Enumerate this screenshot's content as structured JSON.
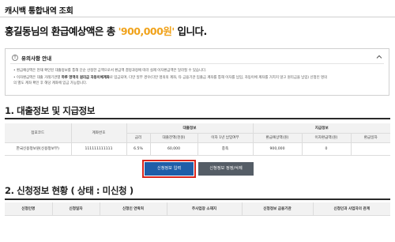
{
  "page": {
    "title": "캐시백 통합내역 조회"
  },
  "summary": {
    "prefix": "홍길동님의 환급예상액은 총 ",
    "amount": "'900,000원'",
    "suffix": " 입니다."
  },
  "notice": {
    "title": "유의사항 안내",
    "line1": "• 환급예상액은 현재 확인된 대출정보를 통해 단순 산정한 금액으로서 환급액 결정과정에 따라 실제 이자환급액은 달라질 수 있습니다.",
    "line2_pre": "• 이자환급액은 대출 거래기관별 ",
    "line2_bold": "하루 영역의 원리금 자동이체계좌",
    "line2_post": "로 입금되며, 다만 일부 경우(다만 명의의 계좌, 타 금융기관 입출금 계좌를 통해 이자를 납입, 자동이체 계좌를 거치지 않고 원리금을 납입) 신청인 명의",
    "line3": "의 별도 계좌 확인 후 해당 계좌에 입금 가능합니다."
  },
  "section1": {
    "title": "1. 대출정보 및 지급정보"
  },
  "loan_table": {
    "headers": {
      "institution": "점포코드",
      "account": "계좌번호",
      "loan_group": "대출정보",
      "payment_group": "지급정보",
      "rate": "금리",
      "loan_balance": "대출잔액(천원)",
      "interest_paid": "이자 1년 납입여부",
      "refund_expected": "환급예상액(원)",
      "interest_refund": "이자환급액(원)",
      "refund_date": "환급일자"
    },
    "row": {
      "institution": "한국신용정보원(신용정보부)",
      "account": "111111111111",
      "rate": "6.5%",
      "loan_balance": "60,000",
      "interest_paid": "충족",
      "refund_expected": "900,000",
      "interest_refund": "0",
      "refund_date": ""
    }
  },
  "buttons": {
    "apply": "신청정보 입력",
    "edit": "신청정보 정정/삭제"
  },
  "section2": {
    "title": "2. 신청정보 현황 ( 상태 : 미신청 )"
  },
  "status_table": {
    "headers": [
      "신청인명",
      "신청일자",
      "신청인 연락처",
      "주사업장 소재지",
      "신청정보 금융기관",
      "신청인과 사업자의 관계"
    ]
  }
}
